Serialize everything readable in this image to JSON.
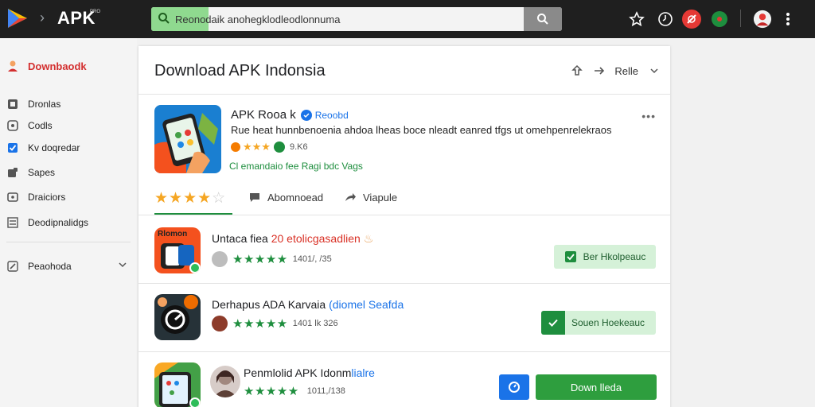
{
  "topbar": {
    "brand": "APK",
    "brand_sup": "PRO",
    "search_value": "Reonodaik anohegklodleodlonnuma"
  },
  "sidebar": {
    "header": "Downbaodk",
    "items": [
      {
        "label": "Dronlas"
      },
      {
        "label": "Codls"
      },
      {
        "label": "Kv doqredar"
      },
      {
        "label": "Sapes"
      },
      {
        "label": "Draiciors"
      },
      {
        "label": "Deodipnalidgs"
      }
    ],
    "footer": "Peaohoda"
  },
  "panel": {
    "title": "Download APK Indonsia",
    "share_label": "Relle"
  },
  "featured": {
    "name": "APK Rooa k",
    "verified_label": "Reoobd",
    "description": "Rue heat hunnbenoenia ahdoa lheas boce nleadt eanred tfgs ut omehpenrelekraos",
    "rating_text": "9.K6",
    "link": "Cl emandaio fee Ragi bdc Vags"
  },
  "tabs": {
    "download": "Abomnoead",
    "share": "Viapule"
  },
  "rows": [
    {
      "icon_text": "Rlomon",
      "title_a": "Untaca fiea",
      "title_b": "20 etolicgasadlien",
      "meta": "1401/, /35",
      "button": "Ber Hkolpeauc"
    },
    {
      "title_a": "Derhapus ADA Karvaia",
      "title_b": "(diomel Seafda",
      "meta": "1401 lk 326",
      "button": "Souen Hoekeauc"
    },
    {
      "title_a": "Penmlolid APK Idonm",
      "title_b": "lialre",
      "meta": "1011,/138",
      "button": "Down lleda"
    }
  ],
  "colors": {
    "accent_green": "#1e8e3e",
    "light_green": "#d5f1d8",
    "accent_red": "#d93025",
    "accent_blue": "#1a73e8"
  }
}
